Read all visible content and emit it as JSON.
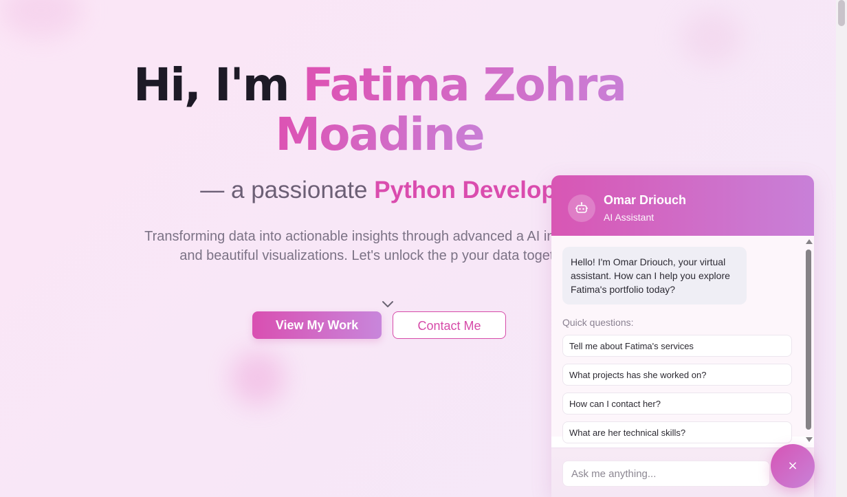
{
  "hero": {
    "greeting": "Hi, I'm ",
    "name_line1": "Fatima Zohra",
    "name_line2": "Moadine",
    "subtitle_prefix": "— a passionate ",
    "subtitle_role": "Python Develop",
    "description": "Transforming data into actionable insights through advanced a AI integration, and beautiful visualizations. Let's unlock the p your data together.",
    "primary_button": "View My Work",
    "secondary_button": "Contact Me",
    "scroll_icon": "chevron-down-icon"
  },
  "chat": {
    "name": "Omar Driouch",
    "role": "AI Assistant",
    "avatar_icon": "robot-icon",
    "greeting": "Hello! I'm Omar Driouch, your virtual assistant. How can I help you explore Fatima's portfolio today?",
    "quick_title": "Quick questions:",
    "quick_questions": [
      "Tell me about Fatima's services",
      "What projects has she worked on?",
      "How can I contact her?",
      "What are her technical skills?"
    ],
    "input_placeholder": "Ask me anything...",
    "close_icon": "close-icon",
    "close_glyph": "×"
  },
  "colors": {
    "accent": "#d94fb1",
    "accent_light": "#c886db",
    "heading": "#1d1a26"
  }
}
